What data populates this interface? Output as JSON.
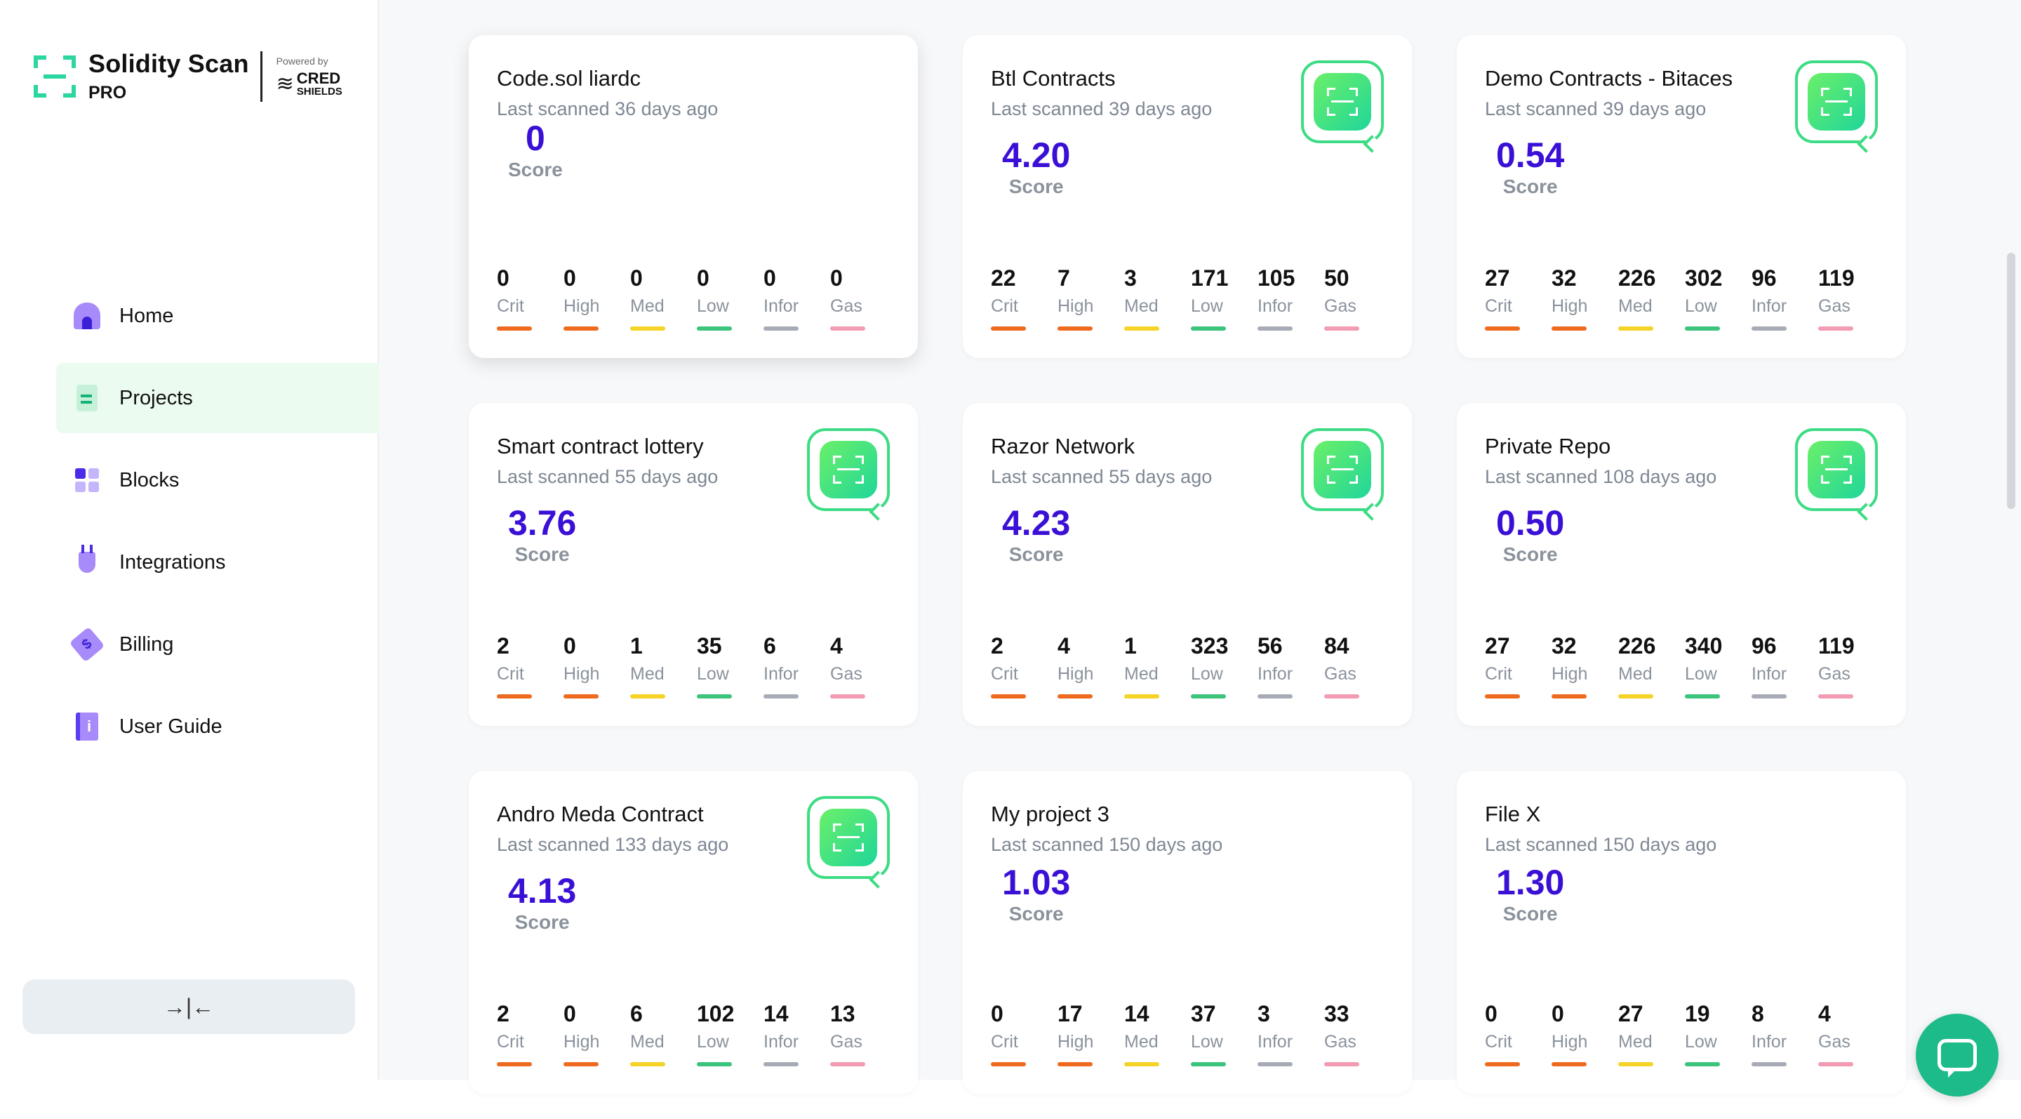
{
  "brand": {
    "title": "Solidity Scan",
    "tier": "PRO",
    "powered_label": "Powered by",
    "powered_brand_top": "CRED",
    "powered_brand_bottom": "SHIELDS"
  },
  "nav": [
    {
      "label": "Home",
      "icon": "home-icon"
    },
    {
      "label": "Projects",
      "icon": "projects-icon",
      "active": true
    },
    {
      "label": "Blocks",
      "icon": "blocks-icon"
    },
    {
      "label": "Integrations",
      "icon": "integrations-icon"
    },
    {
      "label": "Billing",
      "icon": "billing-icon"
    },
    {
      "label": "User Guide",
      "icon": "user-guide-icon"
    }
  ],
  "collapse_icon": "→|←",
  "stat_labels": [
    "Crit",
    "High",
    "Med",
    "Low",
    "Infor",
    "Gas"
  ],
  "stat_colors": [
    "#ee6a1f",
    "#ee6a1f",
    "#f5d327",
    "#3cc47c",
    "#a6abb5",
    "#f29bb2"
  ],
  "score_label": "Score",
  "projects": [
    {
      "name": "Code.sol liardc",
      "scanned": "Last scanned 36 days ago",
      "score": "0",
      "scan_button": false,
      "stats": [
        "0",
        "0",
        "0",
        "0",
        "0",
        "0"
      ]
    },
    {
      "name": "Btl Contracts",
      "scanned": "Last scanned 39 days ago",
      "score": "4.20",
      "scan_button": true,
      "stats": [
        "22",
        "7",
        "3",
        "171",
        "105",
        "50"
      ]
    },
    {
      "name": "Demo Contracts - Bitaces",
      "scanned": "Last scanned 39 days ago",
      "score": "0.54",
      "scan_button": true,
      "stats": [
        "27",
        "32",
        "226",
        "302",
        "96",
        "119"
      ]
    },
    {
      "name": "Smart contract lottery",
      "scanned": "Last scanned 55 days ago",
      "score": "3.76",
      "scan_button": true,
      "stats": [
        "2",
        "0",
        "1",
        "35",
        "6",
        "4"
      ]
    },
    {
      "name": "Razor Network",
      "scanned": "Last scanned 55 days ago",
      "score": "4.23",
      "scan_button": true,
      "stats": [
        "2",
        "4",
        "1",
        "323",
        "56",
        "84"
      ]
    },
    {
      "name": "Private Repo",
      "scanned": "Last scanned 108 days ago",
      "score": "0.50",
      "scan_button": true,
      "stats": [
        "27",
        "32",
        "226",
        "340",
        "96",
        "119"
      ]
    },
    {
      "name": "Andro Meda Contract",
      "scanned": "Last scanned 133 days ago",
      "score": "4.13",
      "scan_button": true,
      "stats": [
        "2",
        "0",
        "6",
        "102",
        "14",
        "13"
      ]
    },
    {
      "name": "My project 3",
      "scanned": "Last scanned 150 days ago",
      "score": "1.03",
      "scan_button": false,
      "stats": [
        "0",
        "17",
        "14",
        "37",
        "3",
        "33"
      ]
    },
    {
      "name": "File X",
      "scanned": "Last scanned 150 days ago",
      "score": "1.30",
      "scan_button": false,
      "stats": [
        "0",
        "0",
        "27",
        "19",
        "8",
        "4"
      ]
    }
  ]
}
